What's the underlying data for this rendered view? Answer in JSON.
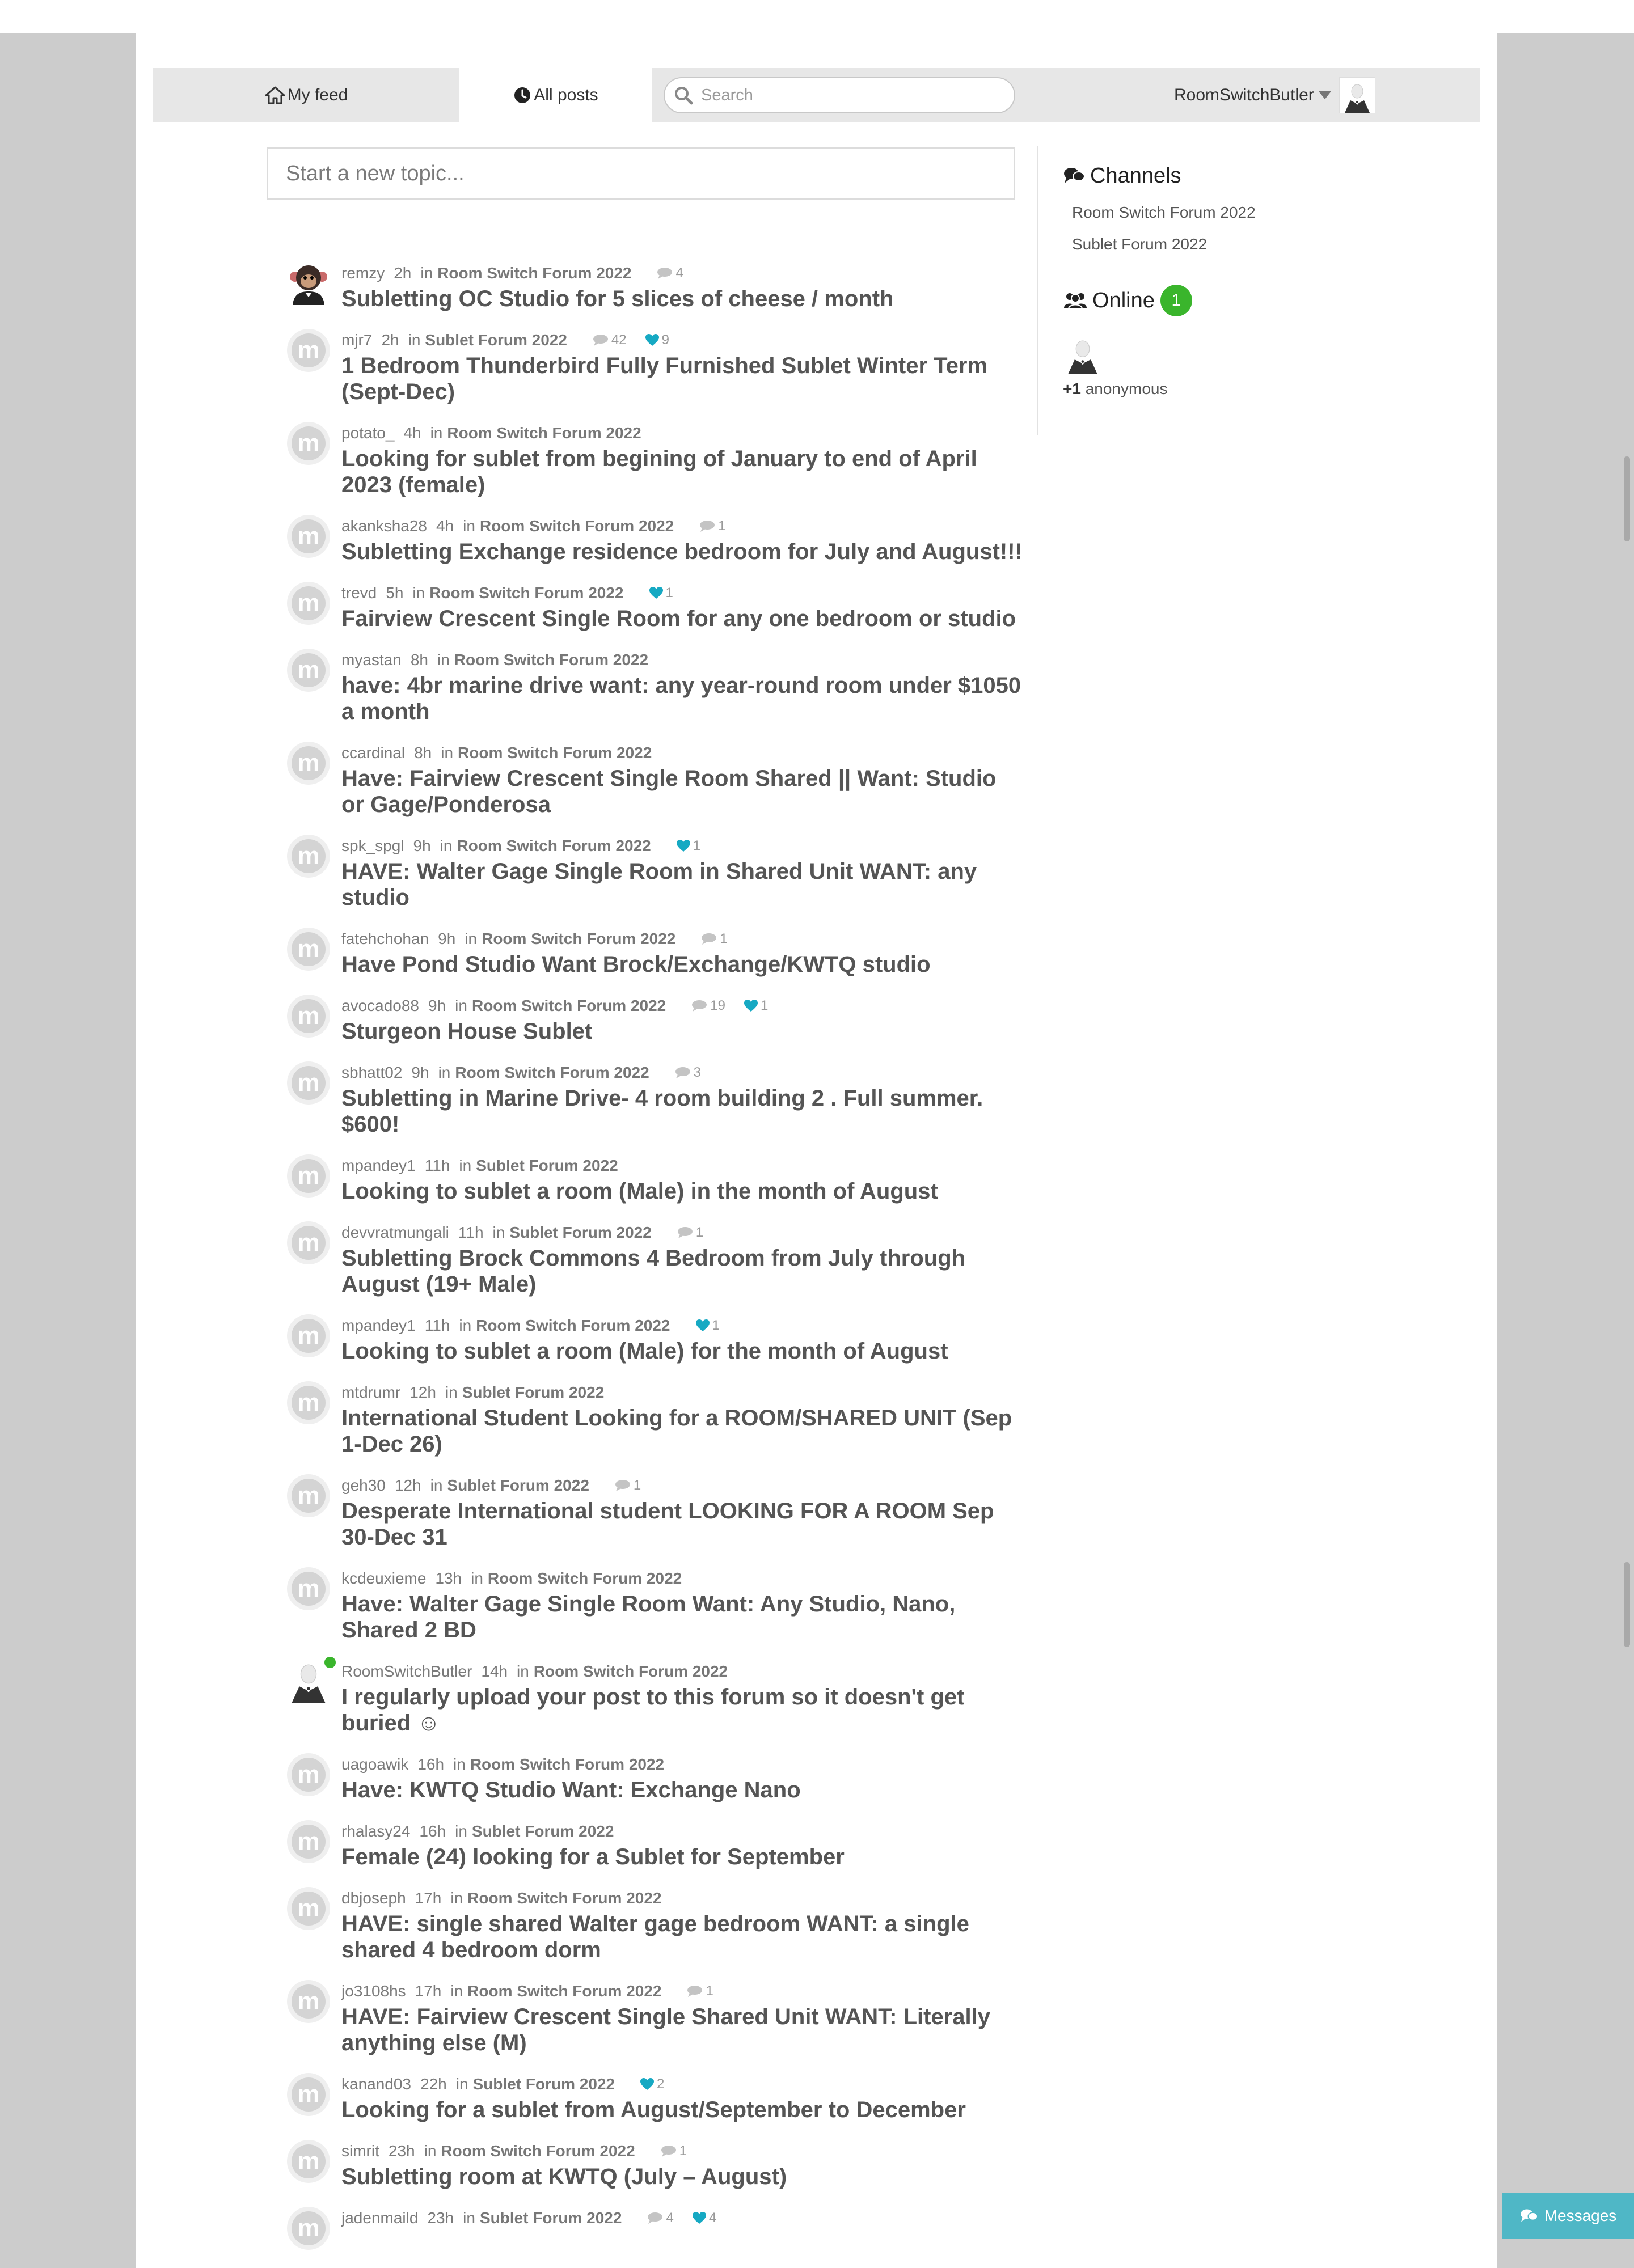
{
  "nav": {
    "my_feed": "My feed",
    "all_posts": "All posts",
    "search_placeholder": "Search",
    "username": "RoomSwitchButler"
  },
  "composer": {
    "placeholder": "Start a new topic..."
  },
  "sidebar": {
    "channels_title": "Channels",
    "channels": [
      "Room Switch Forum 2022",
      "Sublet Forum 2022"
    ],
    "online_title": "Online",
    "online_count": "1",
    "anonymous_count": "+1",
    "anonymous_label": "anonymous"
  },
  "in_label": "in",
  "topics": [
    {
      "user": "remzy",
      "time": "2h",
      "channel": "Room Switch Forum 2022",
      "comments": "4",
      "likes": "",
      "title": "Subletting OC Studio for 5 slices of cheese / month",
      "avatar": "monkey"
    },
    {
      "user": "mjr7",
      "time": "2h",
      "channel": "Sublet Forum 2022",
      "comments": "42",
      "likes": "9",
      "title": "1 Bedroom Thunderbird Fully Furnished Sublet Winter Term (Sept-Dec)",
      "avatar": "m"
    },
    {
      "user": "potato_",
      "time": "4h",
      "channel": "Room Switch Forum 2022",
      "comments": "",
      "likes": "",
      "title": "Looking for sublet from begining of January to end of April 2023 (female)",
      "avatar": "m"
    },
    {
      "user": "akanksha28",
      "time": "4h",
      "channel": "Room Switch Forum 2022",
      "comments": "1",
      "likes": "",
      "title": "Subletting Exchange residence bedroom for July and August!!!",
      "avatar": "m"
    },
    {
      "user": "trevd",
      "time": "5h",
      "channel": "Room Switch Forum 2022",
      "comments": "",
      "likes": "1",
      "title": "Fairview Crescent Single Room for any one bedroom or studio",
      "avatar": "m"
    },
    {
      "user": "myastan",
      "time": "8h",
      "channel": "Room Switch Forum 2022",
      "comments": "",
      "likes": "",
      "title": "have: 4br marine drive want: any year-round room under $1050 a month",
      "avatar": "m"
    },
    {
      "user": "ccardinal",
      "time": "8h",
      "channel": "Room Switch Forum 2022",
      "comments": "",
      "likes": "",
      "title": "Have: Fairview Crescent Single Room Shared || Want: Studio or Gage/Ponderosa",
      "avatar": "m"
    },
    {
      "user": "spk_spgl",
      "time": "9h",
      "channel": "Room Switch Forum 2022",
      "comments": "",
      "likes": "1",
      "title": "HAVE: Walter Gage Single Room in Shared Unit WANT: any studio",
      "avatar": "m"
    },
    {
      "user": "fatehchohan",
      "time": "9h",
      "channel": "Room Switch Forum 2022",
      "comments": "1",
      "likes": "",
      "title": "Have Pond Studio Want Brock/Exchange/KWTQ studio",
      "avatar": "m"
    },
    {
      "user": "avocado88",
      "time": "9h",
      "channel": "Room Switch Forum 2022",
      "comments": "19",
      "likes": "1",
      "title": "Sturgeon House Sublet",
      "avatar": "m"
    },
    {
      "user": "sbhatt02",
      "time": "9h",
      "channel": "Room Switch Forum 2022",
      "comments": "3",
      "likes": "",
      "title": "Subletting in Marine Drive- 4 room building 2 . Full summer. $600!",
      "avatar": "m"
    },
    {
      "user": "mpandey1",
      "time": "11h",
      "channel": "Sublet Forum 2022",
      "comments": "",
      "likes": "",
      "title": "Looking to sublet a room (Male) in the month of August",
      "avatar": "m"
    },
    {
      "user": "devvratmungali",
      "time": "11h",
      "channel": "Sublet Forum 2022",
      "comments": "1",
      "likes": "",
      "title": "Subletting Brock Commons 4 Bedroom from July through August (19+ Male)",
      "avatar": "m"
    },
    {
      "user": "mpandey1",
      "time": "11h",
      "channel": "Room Switch Forum 2022",
      "comments": "",
      "likes": "1",
      "title": "Looking to sublet a room (Male) for the month of August",
      "avatar": "m"
    },
    {
      "user": "mtdrumr",
      "time": "12h",
      "channel": "Sublet Forum 2022",
      "comments": "",
      "likes": "",
      "title": "International Student Looking for a ROOM/SHARED UNIT (Sep 1-Dec 26)",
      "avatar": "m"
    },
    {
      "user": "geh30",
      "time": "12h",
      "channel": "Sublet Forum 2022",
      "comments": "1",
      "likes": "",
      "title": "Desperate International student LOOKING FOR A ROOM Sep 30-Dec 31",
      "avatar": "m"
    },
    {
      "user": "kcdeuxieme",
      "time": "13h",
      "channel": "Room Switch Forum 2022",
      "comments": "",
      "likes": "",
      "title": "Have: Walter Gage Single Room Want: Any Studio, Nano, Shared 2 BD",
      "avatar": "m"
    },
    {
      "user": "RoomSwitchButler",
      "time": "14h",
      "channel": "Room Switch Forum 2022",
      "comments": "",
      "likes": "",
      "title": "I regularly upload your post to this forum so it doesn't get buried ☺",
      "avatar": "butler"
    },
    {
      "user": "uagoawik",
      "time": "16h",
      "channel": "Room Switch Forum 2022",
      "comments": "",
      "likes": "",
      "title": "Have: KWTQ Studio Want: Exchange Nano",
      "avatar": "m"
    },
    {
      "user": "rhalasy24",
      "time": "16h",
      "channel": "Sublet Forum 2022",
      "comments": "",
      "likes": "",
      "title": "Female (24) looking for a Sublet for September",
      "avatar": "m"
    },
    {
      "user": "dbjoseph",
      "time": "17h",
      "channel": "Room Switch Forum 2022",
      "comments": "",
      "likes": "",
      "title": "HAVE: single shared Walter gage bedroom WANT: a single shared 4 bedroom dorm",
      "avatar": "m"
    },
    {
      "user": "jo3108hs",
      "time": "17h",
      "channel": "Room Switch Forum 2022",
      "comments": "1",
      "likes": "",
      "title": "HAVE: Fairview Crescent Single Shared Unit WANT: Literally anything else (M)",
      "avatar": "m"
    },
    {
      "user": "kanand03",
      "time": "22h",
      "channel": "Sublet Forum 2022",
      "comments": "",
      "likes": "2",
      "title": "Looking for a sublet from August/September to December",
      "avatar": "m"
    },
    {
      "user": "simrit",
      "time": "23h",
      "channel": "Room Switch Forum 2022",
      "comments": "1",
      "likes": "",
      "title": "Subletting room at KWTQ (July – August)",
      "avatar": "m"
    },
    {
      "user": "jadenmaild",
      "time": "23h",
      "channel": "Sublet Forum 2022",
      "comments": "4",
      "likes": "4",
      "title": "",
      "avatar": "m"
    }
  ],
  "messages_button": "Messages"
}
